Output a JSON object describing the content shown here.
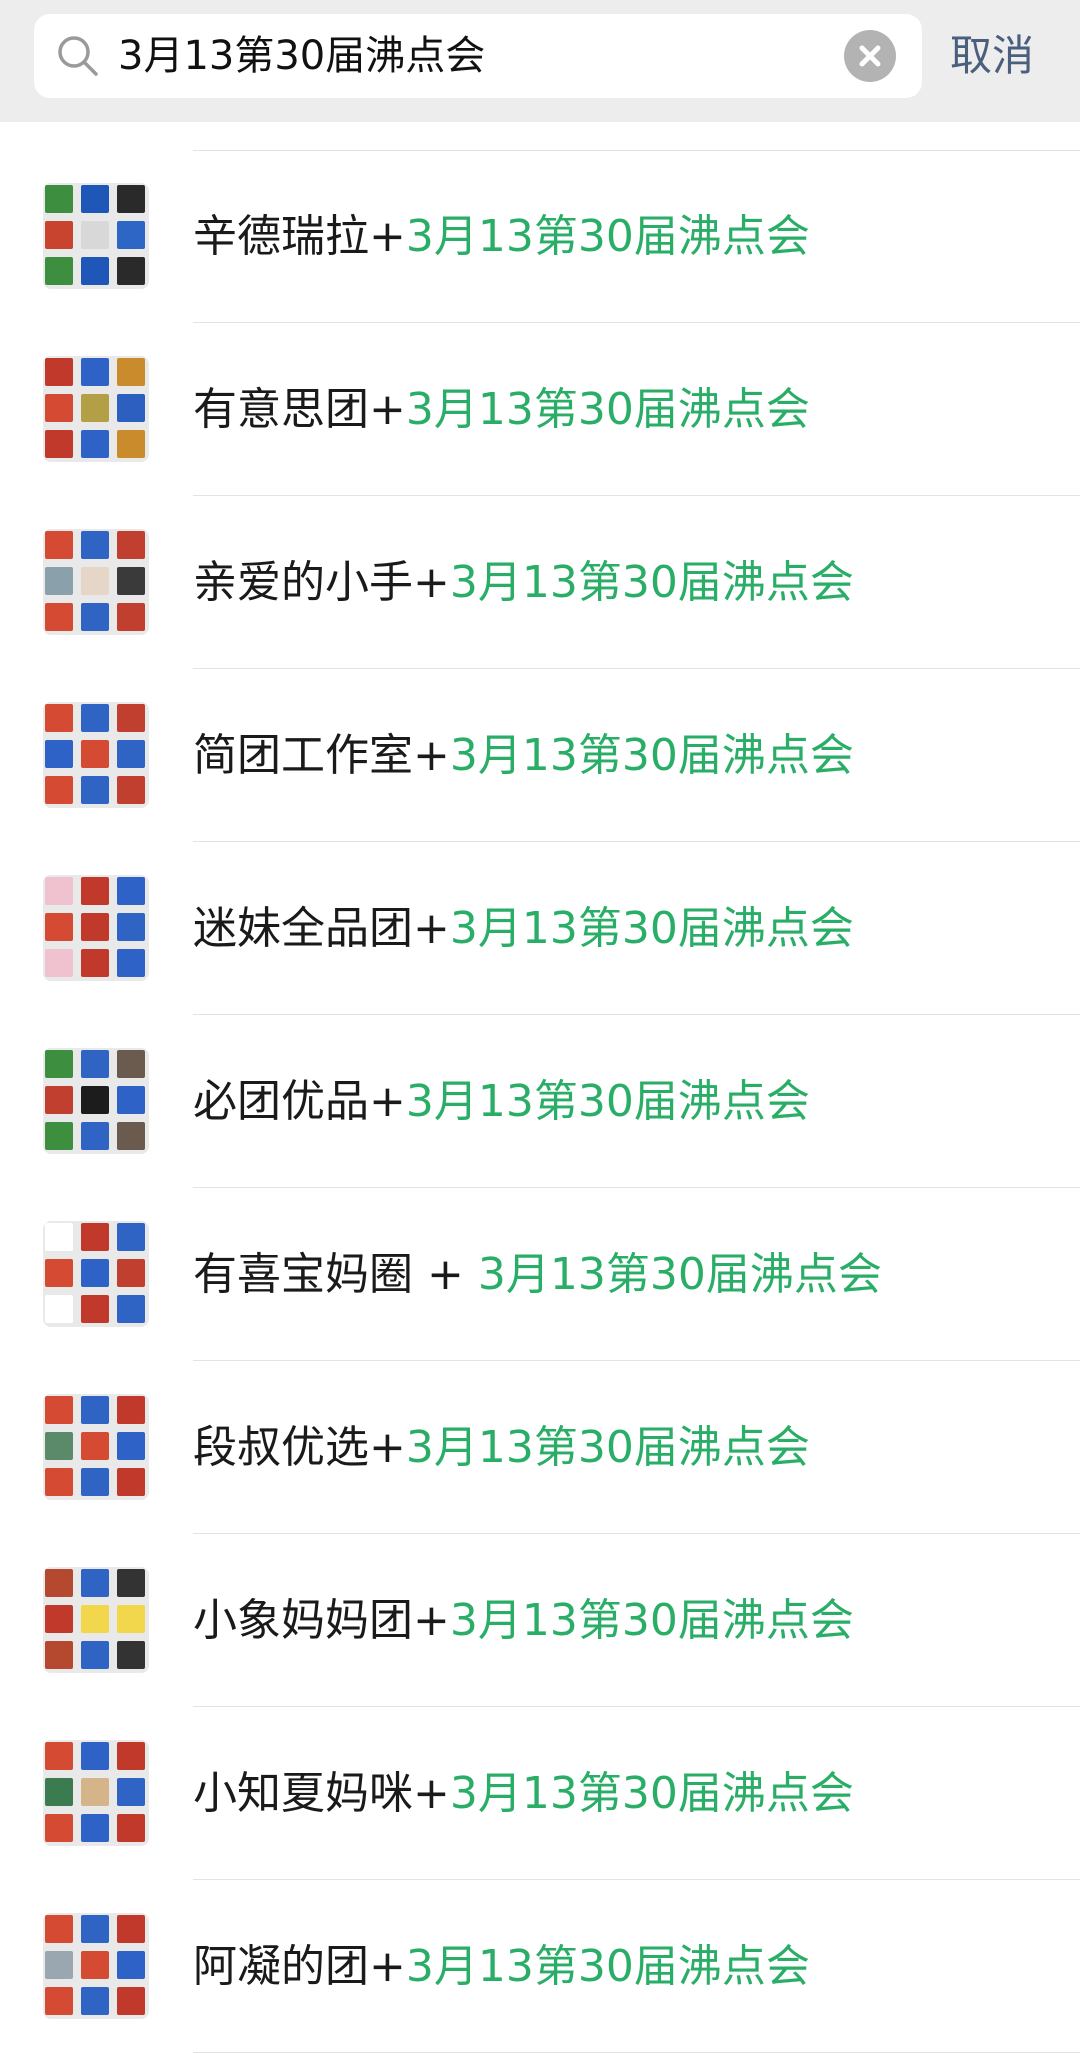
{
  "search": {
    "query": "3月13第30届沸点会",
    "cancel_label": "取消"
  },
  "results": [
    {
      "name": "辛德瑞拉",
      "sep": "+",
      "keyword": "3月13第30届沸点会",
      "thumb_colors": [
        "#3d8f3f",
        "#1e57b8",
        "#2a2a2a",
        "#c9442f",
        "#d8d8d8",
        "#2d66c4"
      ]
    },
    {
      "name": "有意思团",
      "sep": "+",
      "keyword": "3月13第30届沸点会",
      "thumb_colors": [
        "#c0392b",
        "#2e62c7",
        "#c98b2c",
        "#d54a32",
        "#b3a046",
        "#2c5fbf"
      ]
    },
    {
      "name": "亲爱的小手",
      "sep": "+",
      "keyword": "3月13第30届沸点会",
      "thumb_colors": [
        "#d54a32",
        "#2f63c4",
        "#c13f2e",
        "#8aa0ab",
        "#e6d6c8",
        "#3a3a3a"
      ]
    },
    {
      "name": "简团工作室",
      "sep": "+",
      "keyword": "3月13第30届沸点会",
      "thumb_colors": [
        "#d54a32",
        "#2f63c4",
        "#c13f2e",
        "#2e62c7",
        "#d54a32",
        "#2f63c4"
      ]
    },
    {
      "name": "迷妹全品团",
      "sep": "+",
      "keyword": "3月13第30届沸点会",
      "thumb_colors": [
        "#f0c2cf",
        "#c0392b",
        "#2e62c7",
        "#d54a32",
        "#c0392b",
        "#2f63c4"
      ]
    },
    {
      "name": "必团优品",
      "sep": "+",
      "keyword": "3月13第30届沸点会",
      "thumb_colors": [
        "#3d8f3f",
        "#2f63c4",
        "#6b5a4e",
        "#c13f2e",
        "#1c1c1c",
        "#2e62c7"
      ]
    },
    {
      "name": "有喜宝妈圈",
      "sep": " + ",
      "keyword": "3月13第30届沸点会",
      "thumb_colors": [
        "#ffffff",
        "#c0392b",
        "#2f63c4",
        "#d54a32",
        "#2e62c7",
        "#c13f2e"
      ]
    },
    {
      "name": "段叔优选",
      "sep": "+",
      "keyword": "3月13第30届沸点会",
      "thumb_colors": [
        "#d54a32",
        "#2f63c4",
        "#c0392b",
        "#5b8a6b",
        "#d54a32",
        "#2e62c7"
      ]
    },
    {
      "name": "小象妈妈团",
      "sep": "+",
      "keyword": "3月13第30届沸点会",
      "thumb_colors": [
        "#b5492f",
        "#2f63c4",
        "#333333",
        "#c0392b",
        "#f2d64b",
        "#f2d64b"
      ]
    },
    {
      "name": "小知夏妈咪",
      "sep": "+",
      "keyword": "3月13第30届沸点会",
      "thumb_colors": [
        "#d54a32",
        "#2e62c7",
        "#c0392b",
        "#3c7a4f",
        "#d6b48a",
        "#2f63c4"
      ]
    },
    {
      "name": "阿凝的团",
      "sep": "+",
      "keyword": "3月13第30届沸点会",
      "thumb_colors": [
        "#d54a32",
        "#2f63c4",
        "#c0392b",
        "#9aa7b0",
        "#d54a32",
        "#2e62c7"
      ]
    }
  ],
  "colors": {
    "highlight": "#2aae67",
    "cancel": "#4a5e7d"
  }
}
